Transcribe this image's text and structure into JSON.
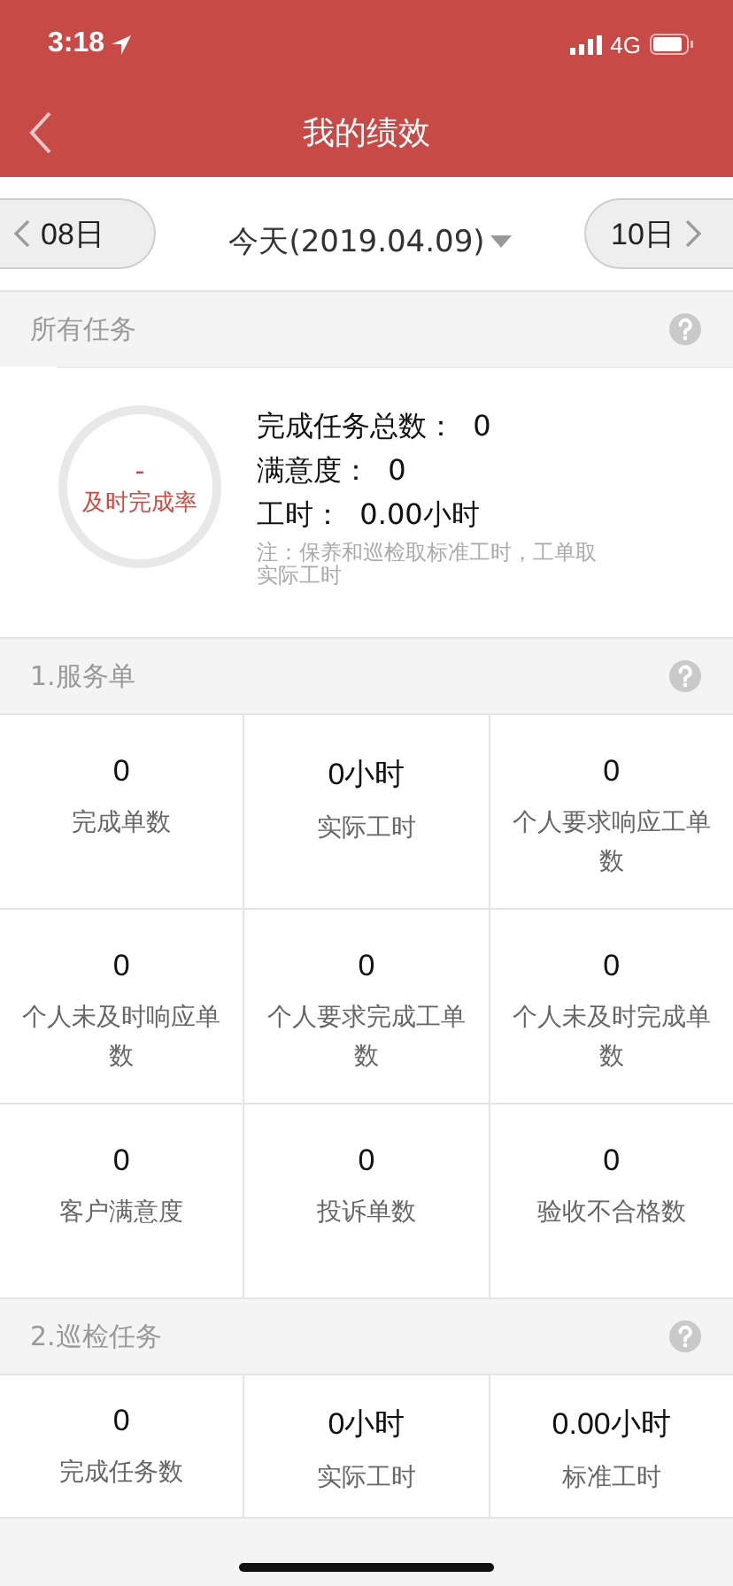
{
  "status_bar": {
    "time": "3:18",
    "network": "4G"
  },
  "nav": {
    "title": "我的绩效"
  },
  "date_bar": {
    "prev": "08日",
    "current": "今天(2019.04.09)",
    "next": "10日"
  },
  "summary": {
    "header": "所有任务",
    "rate_value": "-",
    "rate_label": "及时完成率",
    "lines": [
      "完成任务总数：  0",
      "满意度：  0",
      "工时：  0.00小时"
    ],
    "note": "注：保养和巡检取标准工时，工单取实际工时"
  },
  "sections": [
    {
      "title": "1.服务单",
      "cells": [
        {
          "value": "0",
          "label": "完成单数"
        },
        {
          "value": "0小时",
          "label": "实际工时"
        },
        {
          "value": "0",
          "label": "个人要求响应工单数"
        },
        {
          "value": "0",
          "label": "个人未及时响应单数"
        },
        {
          "value": "0",
          "label": "个人要求完成工单数"
        },
        {
          "value": "0",
          "label": "个人未及时完成单数"
        },
        {
          "value": "0",
          "label": "客户满意度"
        },
        {
          "value": "0",
          "label": "投诉单数"
        },
        {
          "value": "0",
          "label": "验收不合格数"
        }
      ]
    },
    {
      "title": "2.巡检任务",
      "cells": [
        {
          "value": "0",
          "label": "完成任务数"
        },
        {
          "value": "0小时",
          "label": "实际工时"
        },
        {
          "value": "0.00小时",
          "label": "标准工时"
        }
      ]
    }
  ]
}
